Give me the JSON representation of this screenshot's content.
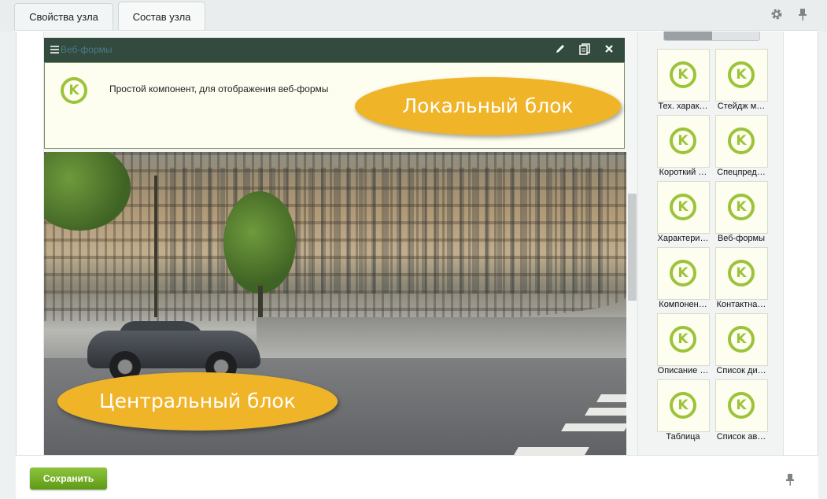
{
  "tabs": [
    {
      "label": "Свойства узла",
      "active": false
    },
    {
      "label": "Состав узла",
      "active": true
    }
  ],
  "toolbar_icons": {
    "settings": "gear-icon",
    "pin": "pin-icon"
  },
  "block": {
    "title": "Веб-формы",
    "description": "Простой компонент, для отображения веб-формы",
    "actions": [
      "edit-icon",
      "copy-icon",
      "close-icon"
    ]
  },
  "callouts": {
    "local": "Локальный блок",
    "central": "Центральный блок"
  },
  "palette": {
    "items": [
      {
        "label": "Тех. харак…"
      },
      {
        "label": "Стейдж м…"
      },
      {
        "label": "Короткий …"
      },
      {
        "label": "Спецпред…"
      },
      {
        "label": "Характери…"
      },
      {
        "label": "Веб-формы"
      },
      {
        "label": "Компонен…"
      },
      {
        "label": "Контактна…"
      },
      {
        "label": "Описание …"
      },
      {
        "label": "Список ди…"
      },
      {
        "label": "Таблица"
      },
      {
        "label": "Список ав…"
      }
    ]
  },
  "footer": {
    "save_label": "Сохранить"
  },
  "colors": {
    "accent_green": "#9cc33a",
    "callout": "#f0b428",
    "header_dark": "#334a3f",
    "save_button": "#6aa81f"
  }
}
